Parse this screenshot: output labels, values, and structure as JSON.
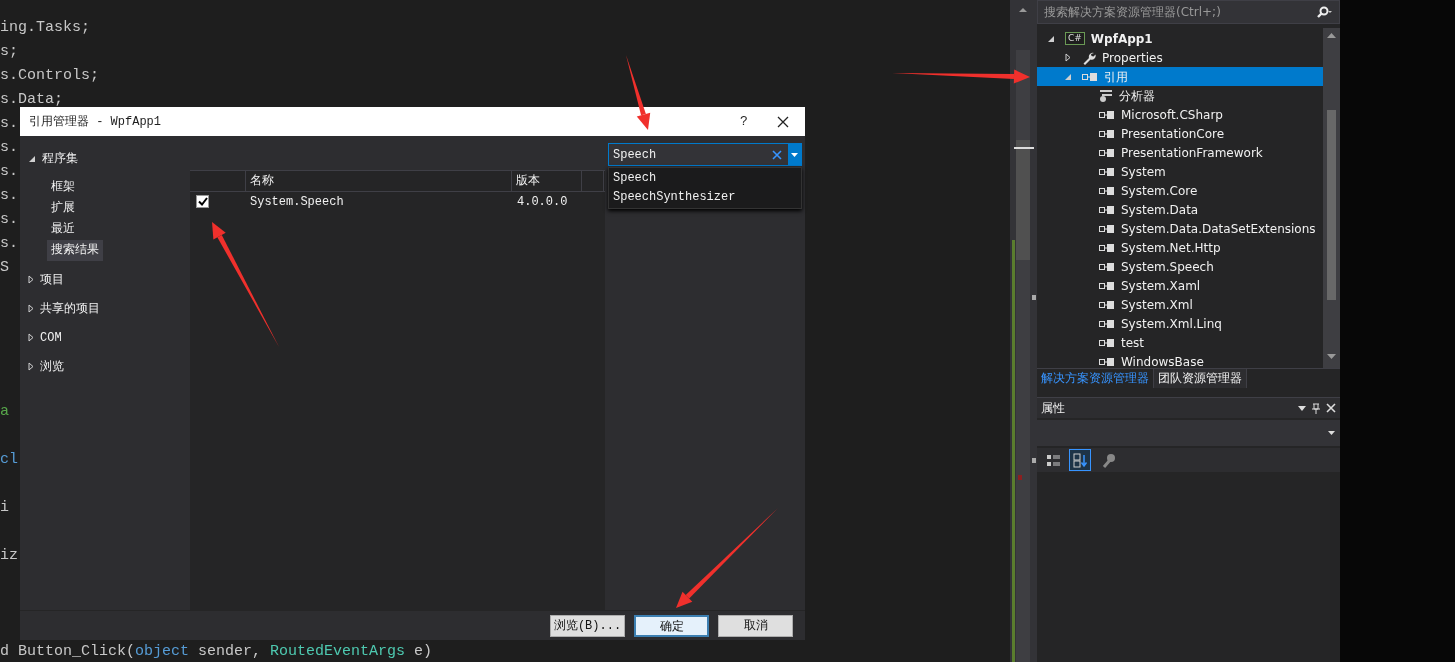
{
  "editor": {
    "lines": [
      {
        "segments": [
          {
            "text": "ing.Tasks;",
            "kind": "plain"
          }
        ]
      },
      {
        "segments": [
          {
            "text": "s;",
            "kind": "plain"
          }
        ]
      },
      {
        "segments": [
          {
            "text": "s.Controls;",
            "kind": "plain"
          }
        ]
      },
      {
        "segments": [
          {
            "text": "s.Data;",
            "kind": "plain"
          }
        ]
      },
      {
        "segments": [
          {
            "text": "s.",
            "kind": "plain"
          }
        ]
      },
      {
        "segments": [
          {
            "text": "s.",
            "kind": "plain"
          }
        ]
      },
      {
        "segments": [
          {
            "text": "s.",
            "kind": "plain"
          }
        ]
      },
      {
        "segments": [
          {
            "text": "s.",
            "kind": "plain"
          }
        ]
      },
      {
        "segments": [
          {
            "text": "s.",
            "kind": "plain"
          }
        ]
      },
      {
        "segments": [
          {
            "text": "s.",
            "kind": "plain"
          }
        ]
      },
      {
        "segments": [
          {
            "text": "S",
            "kind": "plain"
          }
        ]
      },
      {
        "segments": [
          {
            "text": "a",
            "kind": "comment"
          }
        ]
      },
      {
        "segments": [
          {
            "text": "cl",
            "kind": "keyword"
          }
        ]
      },
      {
        "segments": [
          {
            "text": "i",
            "kind": "plain"
          }
        ]
      },
      {
        "segments": [
          {
            "text": "iz",
            "kind": "plain"
          }
        ]
      },
      {
        "segments": [
          {
            "text": "d Button_Click(",
            "kind": "plain"
          },
          {
            "text": "object",
            "kind": "keyword"
          },
          {
            "text": " sender, ",
            "kind": "plain"
          },
          {
            "text": "RoutedEventArgs",
            "kind": "type"
          },
          {
            "text": " e)",
            "kind": "plain"
          }
        ]
      }
    ]
  },
  "dialog": {
    "title": "引用管理器 - WpfApp1",
    "help": "?",
    "nav": [
      {
        "label": "程序集",
        "expanded": true,
        "children": [
          {
            "label": "框架",
            "selected": false
          },
          {
            "label": "扩展",
            "selected": false
          },
          {
            "label": "最近",
            "selected": false
          },
          {
            "label": "搜索结果",
            "selected": true
          }
        ]
      },
      {
        "label": "项目",
        "expanded": false
      },
      {
        "label": "共享的项目",
        "expanded": false
      },
      {
        "label": "COM",
        "expanded": false
      },
      {
        "label": "浏览",
        "expanded": false
      }
    ],
    "table": {
      "columns": [
        "名称",
        "版本"
      ],
      "rows": [
        {
          "checked": true,
          "name": "System.Speech",
          "version": "4.0.0.0"
        }
      ]
    },
    "search": {
      "value": "Speech",
      "suggestions": [
        "Speech",
        "SpeechSynthesizer"
      ]
    },
    "buttons": [
      {
        "label": "浏览(B)...",
        "default": false
      },
      {
        "label": "确定",
        "default": true
      },
      {
        "label": "取消",
        "default": false
      }
    ]
  },
  "solution_explorer": {
    "search": {
      "placeholder": "搜索解决方案资源管理器(Ctrl+;)"
    },
    "tree": [
      {
        "label": "WpfApp1",
        "kind": "project",
        "icon_text": "C#",
        "expanded": true,
        "selected": false,
        "children": [
          {
            "label": "Properties",
            "kind": "properties",
            "expanded": false,
            "selected": false
          },
          {
            "label": "引用",
            "kind": "references",
            "expanded": true,
            "selected": true,
            "children": [
              {
                "label": "分析器",
                "kind": "analyzer",
                "selected": false
              },
              {
                "label": "Microsoft.CSharp",
                "kind": "reference",
                "selected": false
              },
              {
                "label": "PresentationCore",
                "kind": "reference",
                "selected": false
              },
              {
                "label": "PresentationFramework",
                "kind": "reference",
                "selected": false
              },
              {
                "label": "System",
                "kind": "reference",
                "selected": false
              },
              {
                "label": "System.Core",
                "kind": "reference",
                "selected": false
              },
              {
                "label": "System.Data",
                "kind": "reference",
                "selected": false
              },
              {
                "label": "System.Data.DataSetExtensions",
                "kind": "reference",
                "selected": false
              },
              {
                "label": "System.Net.Http",
                "kind": "reference",
                "selected": false
              },
              {
                "label": "System.Speech",
                "kind": "reference",
                "selected": false
              },
              {
                "label": "System.Xaml",
                "kind": "reference",
                "selected": false
              },
              {
                "label": "System.Xml",
                "kind": "reference",
                "selected": false
              },
              {
                "label": "System.Xml.Linq",
                "kind": "reference",
                "selected": false
              },
              {
                "label": "test",
                "kind": "reference",
                "selected": false
              },
              {
                "label": "WindowsBase",
                "kind": "reference",
                "selected": false
              }
            ]
          }
        ]
      }
    ],
    "tabs": [
      {
        "label": "解决方案资源管理器",
        "selected": true
      },
      {
        "label": "团队资源管理器",
        "selected": false
      }
    ]
  },
  "properties_panel": {
    "title": "属性",
    "toolbar": [
      {
        "kind": "categorized",
        "selected": false
      },
      {
        "kind": "alphabetical",
        "selected": true
      },
      {
        "kind": "events",
        "selected": false
      }
    ]
  }
}
